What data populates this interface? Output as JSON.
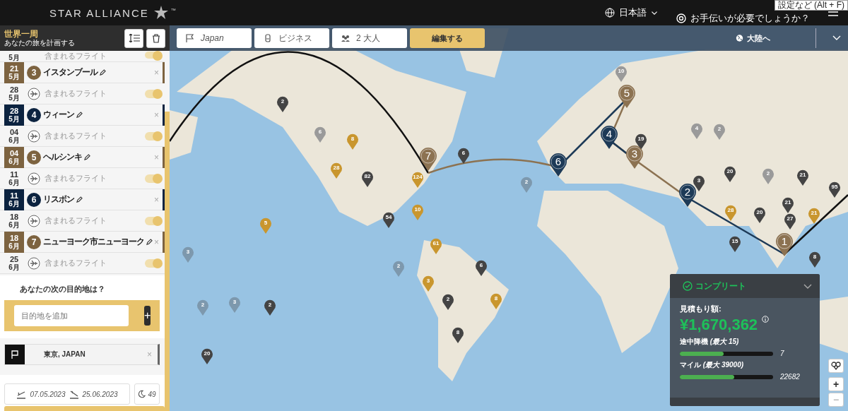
{
  "top_bar": {
    "logo": "STAR ALLIANCE",
    "trademark": "™",
    "language": "日本語",
    "help": "お手伝いが必要でしょうか？",
    "tooltip": "設定など (Alt + F)"
  },
  "sidebar": {
    "title": "世界一周",
    "subtitle": "あなたの旅を計画する",
    "itinerary": [
      {
        "kind": "flight",
        "month": "5月",
        "label": "含まれるフライト",
        "on": true
      },
      {
        "kind": "stop",
        "day": "21",
        "month": "5月",
        "number": "3",
        "name": "イスタンブール",
        "remove": "×",
        "color": "#7d6340"
      },
      {
        "kind": "flight",
        "day": "28",
        "month": "5月",
        "label": "含まれるフライト",
        "on": true
      },
      {
        "kind": "stop",
        "day": "28",
        "month": "5月",
        "number": "4",
        "name": "ウィーン",
        "remove": "×",
        "color": "#0c2340"
      },
      {
        "kind": "flight",
        "day": "04",
        "month": "6月",
        "label": "含まれるフライト",
        "on": true
      },
      {
        "kind": "stop",
        "day": "04",
        "month": "6月",
        "number": "5",
        "name": "ヘルシンキ",
        "remove": "×",
        "color": "#7d6340"
      },
      {
        "kind": "flight",
        "day": "11",
        "month": "6月",
        "label": "含まれるフライト",
        "on": true
      },
      {
        "kind": "stop",
        "day": "11",
        "month": "6月",
        "number": "6",
        "name": "リスボン",
        "remove": "×",
        "color": "#0c2340"
      },
      {
        "kind": "flight",
        "day": "18",
        "month": "6月",
        "label": "含まれるフライト",
        "on": true
      },
      {
        "kind": "stop",
        "day": "18",
        "month": "6月",
        "number": "7",
        "name": "ニューヨーク市ニューヨーク",
        "remove": "×",
        "color": "#7d6340"
      },
      {
        "kind": "flight",
        "day": "25",
        "month": "6月",
        "label": "含まれるフライト",
        "on": true
      }
    ],
    "next_prompt": "あなたの次の目的地は？",
    "destination_placeholder": "目的地を追加",
    "add_button": "+",
    "origin": "東京, JAPAN",
    "remove_origin": "×",
    "depart_date": "07.05.2023",
    "return_date": "25.06.2023",
    "nights": "49"
  },
  "map": {
    "filters": [
      {
        "kind": "country",
        "value": "Japan"
      },
      {
        "kind": "cabin",
        "value": "ビジネス"
      },
      {
        "kind": "travellers",
        "value": "2 大人"
      }
    ],
    "edit_button": "編集する",
    "continent_button": "大陸へ",
    "stops": [
      {
        "number": "1",
        "color": "#8c7251"
      },
      {
        "number": "2",
        "color": "#1d3a57"
      },
      {
        "number": "3",
        "color": "#8c7251"
      },
      {
        "number": "4",
        "color": "#1d3a57"
      },
      {
        "number": "5",
        "color": "#8c7251"
      },
      {
        "number": "6",
        "color": "#1d3a57"
      },
      {
        "number": "7",
        "color": "#8c7251"
      }
    ],
    "clusters": [
      {
        "count": "2",
        "color": "#444444"
      },
      {
        "count": "6",
        "color": "#9a9a9a"
      },
      {
        "count": "8",
        "color": "#c9962e"
      },
      {
        "count": "28",
        "color": "#c9962e"
      },
      {
        "count": "82",
        "color": "#444444"
      },
      {
        "count": "124",
        "color": "#c9962e"
      },
      {
        "count": "6",
        "color": "#444444"
      },
      {
        "count": "10",
        "color": "#c9962e"
      },
      {
        "count": "54",
        "color": "#444444"
      },
      {
        "count": "5",
        "color": "#c9962e"
      },
      {
        "count": "61",
        "color": "#c9962e"
      },
      {
        "count": "3",
        "color": "#7d98ad"
      },
      {
        "count": "2",
        "color": "#7d98ad"
      },
      {
        "count": "6",
        "color": "#444444"
      },
      {
        "count": "3",
        "color": "#c9962e"
      },
      {
        "count": "2",
        "color": "#7d98ad"
      },
      {
        "count": "3",
        "color": "#7d98ad"
      },
      {
        "count": "2",
        "color": "#444444"
      },
      {
        "count": "2",
        "color": "#444444"
      },
      {
        "count": "8",
        "color": "#c9962e"
      },
      {
        "count": "8",
        "color": "#444444"
      },
      {
        "count": "20",
        "color": "#444444"
      },
      {
        "count": "10",
        "color": "#9a9a9a"
      },
      {
        "count": "19",
        "color": "#444444"
      },
      {
        "count": "4",
        "color": "#9a9a9a"
      },
      {
        "count": "2",
        "color": "#9a9a9a"
      },
      {
        "count": "20",
        "color": "#444444"
      },
      {
        "count": "3",
        "color": "#444444"
      },
      {
        "count": "2",
        "color": "#9a9a9a"
      },
      {
        "count": "21",
        "color": "#444444"
      },
      {
        "count": "95",
        "color": "#444444"
      },
      {
        "count": "21",
        "color": "#444444"
      },
      {
        "count": "28",
        "color": "#c9962e"
      },
      {
        "count": "20",
        "color": "#444444"
      },
      {
        "count": "21",
        "color": "#c9962e"
      },
      {
        "count": "15",
        "color": "#444444"
      },
      {
        "count": "27",
        "color": "#444444"
      },
      {
        "count": "8",
        "color": "#444444"
      },
      {
        "count": "2",
        "color": "#7d98ad"
      }
    ],
    "summary": {
      "status": "コンプリート",
      "estimate_label": "見積もり額:",
      "price": "¥1,670,362",
      "meters": [
        {
          "label": "途中降機 *(最大 15)*",
          "level": 0.47,
          "reading": "7"
        },
        {
          "label": "マイル *(最大 39000)*",
          "level": 0.58,
          "reading": "22682"
        }
      ]
    },
    "zoom_in": "+",
    "zoom_out": "−"
  }
}
